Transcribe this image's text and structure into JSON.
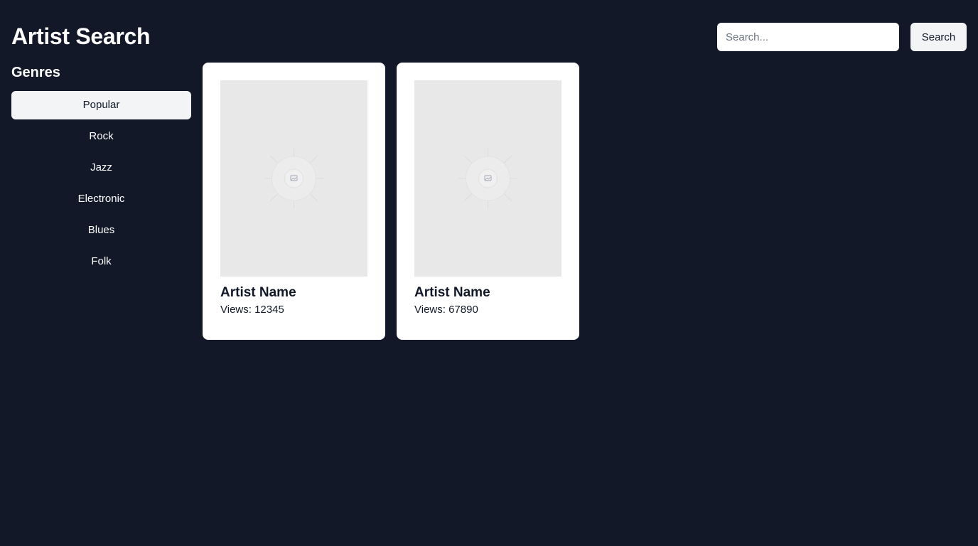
{
  "header": {
    "title": "Artist Search",
    "search_placeholder": "Search...",
    "search_value": "",
    "search_button_label": "Search"
  },
  "sidebar": {
    "title": "Genres",
    "items": [
      {
        "label": "Popular",
        "active": true
      },
      {
        "label": "Rock",
        "active": false
      },
      {
        "label": "Jazz",
        "active": false
      },
      {
        "label": "Electronic",
        "active": false
      },
      {
        "label": "Blues",
        "active": false
      },
      {
        "label": "Folk",
        "active": false
      }
    ]
  },
  "artists": [
    {
      "name": "Artist Name",
      "views": "Views: 12345",
      "image_icon": "image-placeholder-icon"
    },
    {
      "name": "Artist Name",
      "views": "Views: 67890",
      "image_icon": "image-placeholder-icon"
    }
  ],
  "colors": {
    "background": "#121828",
    "card": "#ffffff",
    "active_item": "#f3f4f6",
    "placeholder": "#e8e8e8"
  }
}
